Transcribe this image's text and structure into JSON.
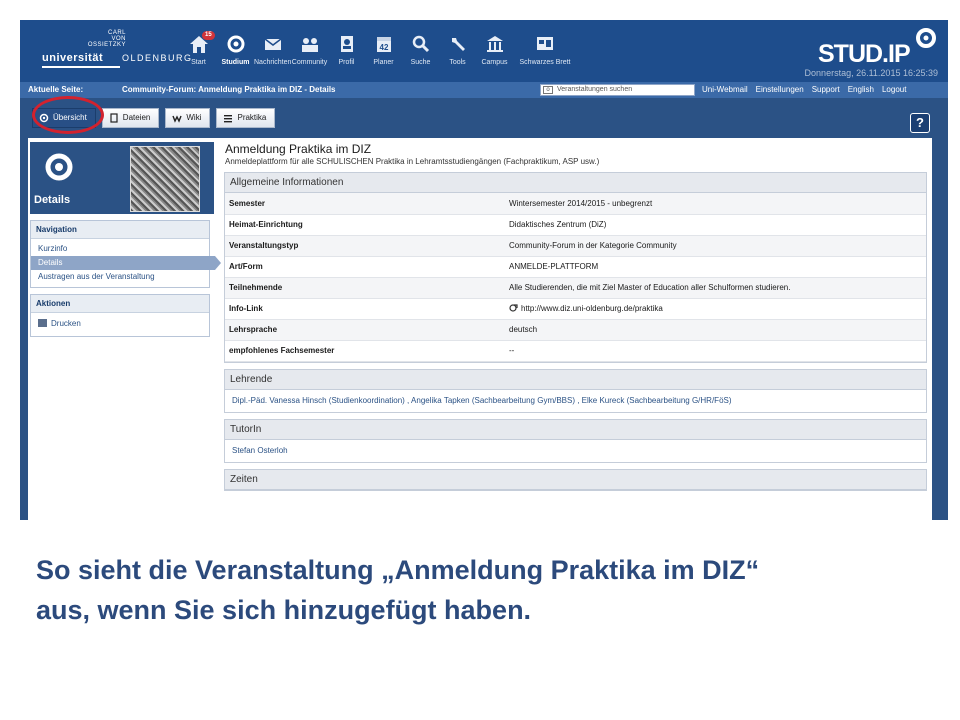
{
  "header": {
    "logo": {
      "small": "CARL\nVON\nOSSIETZKY",
      "big": "universität",
      "city": "OLDENBURG"
    },
    "nav": [
      {
        "label": "Start",
        "icon": "home-icon",
        "badge": "15"
      },
      {
        "label": "Studium",
        "icon": "studium-icon",
        "active": true
      },
      {
        "label": "Nachrichten",
        "icon": "mail-icon"
      },
      {
        "label": "Community",
        "icon": "community-icon"
      },
      {
        "label": "Profil",
        "icon": "profile-icon"
      },
      {
        "label": "Planer",
        "icon": "calendar-icon"
      },
      {
        "label": "Suche",
        "icon": "search-icon"
      },
      {
        "label": "Tools",
        "icon": "wrench-icon"
      },
      {
        "label": "Campus",
        "icon": "building-icon"
      },
      {
        "label": "Schwarzes Brett",
        "icon": "board-icon"
      }
    ],
    "brand": "STUD.IP",
    "date": "Donnerstag, 26.11.2015 16:25:39"
  },
  "crumb": {
    "label": "Aktuelle Seite:",
    "path": "Community-Forum: Anmeldung Praktika im DIZ - Details",
    "search_placeholder": "Veranstaltungen suchen",
    "links": [
      "Uni-Webmail",
      "Einstellungen",
      "Support",
      "English",
      "Logout"
    ]
  },
  "tabs": [
    {
      "label": "Übersicht",
      "active": true
    },
    {
      "label": "Dateien"
    },
    {
      "label": "Wiki"
    },
    {
      "label": "Praktika"
    }
  ],
  "help_label": "?",
  "sidebar": {
    "head_label": "Details",
    "navigation_title": "Navigation",
    "navigation": [
      "Kurzinfo",
      "Details",
      "Austragen aus der Veranstaltung"
    ],
    "actions_title": "Aktionen",
    "actions": [
      "Drucken"
    ]
  },
  "course": {
    "title": "Anmeldung Praktika im DIZ",
    "subtitle": "Anmeldeplattform für alle SCHULISCHEN Praktika in Lehramtsstudiengängen (Fachpraktikum, ASP usw.)",
    "general_title": "Allgemeine Informationen",
    "general": [
      {
        "key": "Semester",
        "value": "Wintersemester 2014/2015 - unbegrenzt"
      },
      {
        "key": "Heimat-Einrichtung",
        "value": "Didaktisches Zentrum (DiZ)",
        "link": true
      },
      {
        "key": "Veranstaltungstyp",
        "value": "Community-Forum in der Kategorie Community"
      },
      {
        "key": "Art/Form",
        "value": "ANMELDE-PLATTFORM"
      },
      {
        "key": "Teilnehmende",
        "value": "Alle Studierenden, die mit Ziel Master of Education aller Schulformen studieren."
      },
      {
        "key": "Info-Link",
        "value": "http://www.diz.uni-oldenburg.de/praktika",
        "link": true
      },
      {
        "key": "Lehrsprache",
        "value": "deutsch"
      },
      {
        "key": "empfohlenes Fachsemester",
        "value": "--"
      }
    ],
    "lecturers_title": "Lehrende",
    "lecturers": "Dipl.-Päd. Vanessa Hinsch (Studienkoordination) ,  Angelika Tapken (Sachbearbeitung Gym/BBS) ,  Elke Kureck (Sachbearbeitung G/HR/FöS)",
    "tutor_title": "TutorIn",
    "tutor": "Stefan Osterloh",
    "times_title": "Zeiten"
  },
  "caption": {
    "line1": "So sieht die Veranstaltung „Anmeldung Praktika im DIZ“",
    "line2": "aus, wenn Sie sich hinzugefügt haben."
  }
}
